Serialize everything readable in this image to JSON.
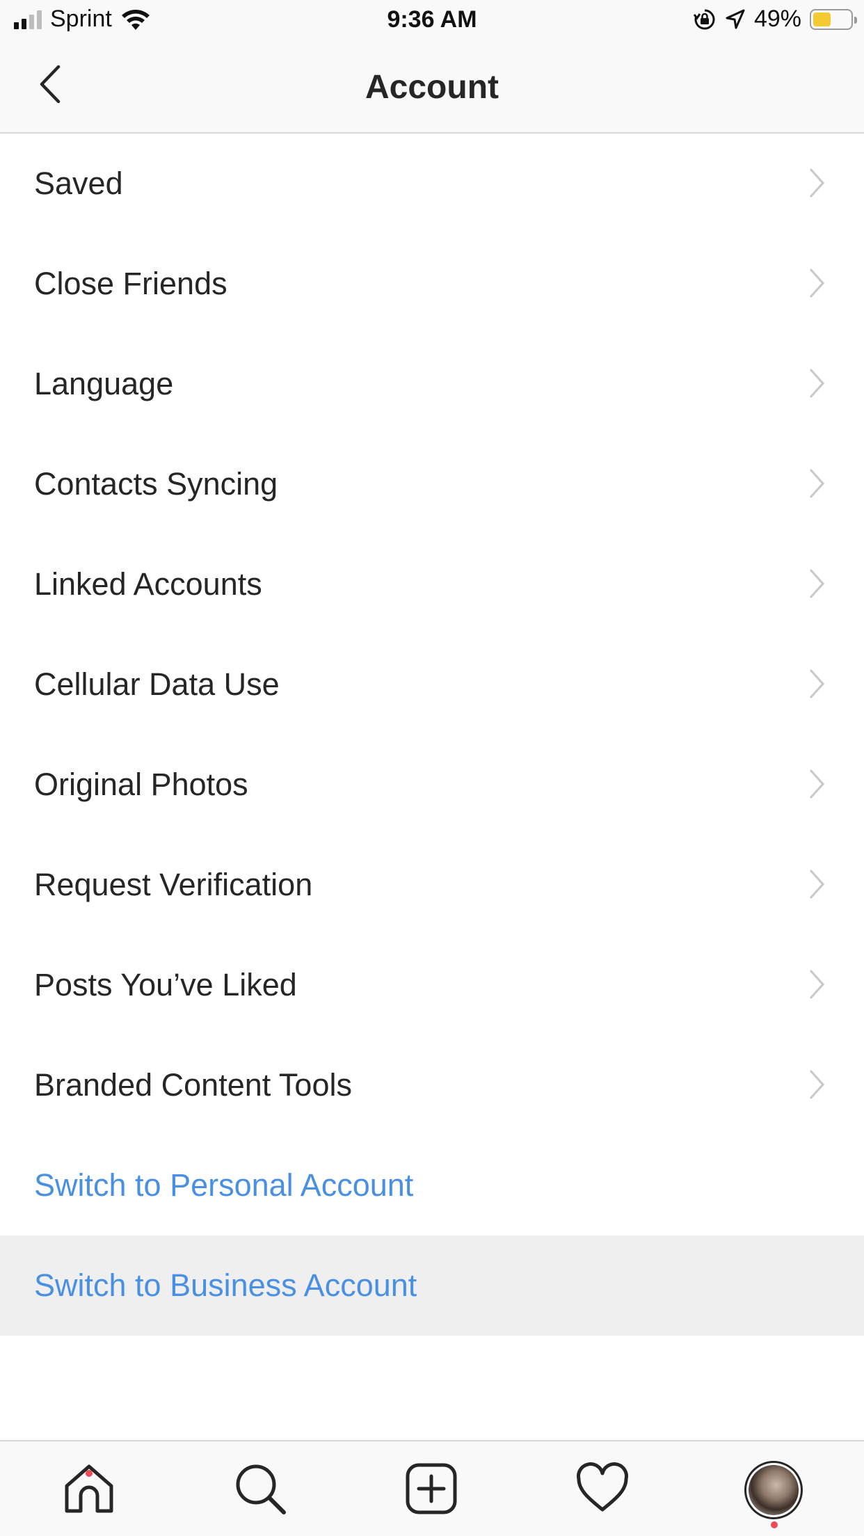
{
  "status_bar": {
    "carrier": "Sprint",
    "time": "9:36 AM",
    "battery_percent": "49%",
    "battery_level": 0.49,
    "battery_color": "#f5c932"
  },
  "nav": {
    "title": "Account",
    "back_icon": "chevron-left-icon"
  },
  "menu": {
    "items": [
      {
        "label": "Saved"
      },
      {
        "label": "Close Friends"
      },
      {
        "label": "Language"
      },
      {
        "label": "Contacts Syncing"
      },
      {
        "label": "Linked Accounts"
      },
      {
        "label": "Cellular Data Use"
      },
      {
        "label": "Original Photos"
      },
      {
        "label": "Request Verification"
      },
      {
        "label": "Posts You’ve Liked"
      },
      {
        "label": "Branded Content Tools"
      }
    ],
    "switch_personal": "Switch to Personal Account",
    "switch_business": "Switch to Business Account",
    "link_color": "#4a90e2"
  },
  "tab_bar": {
    "tabs": [
      "home-icon",
      "search-icon",
      "new-post-icon",
      "activity-heart-icon",
      "profile-avatar"
    ],
    "notification_color": "#ed4956"
  }
}
